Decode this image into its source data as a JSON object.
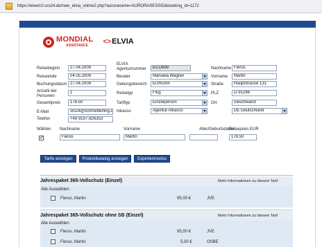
{
  "browser": {
    "url": "https://www10.sro24.de/new_elvia_online2.php?auroraname=AURORASESSID&booking_id=1172"
  },
  "logos": {
    "mondial_name": "MONDIAL",
    "mondial_sub": "ASSISTANCE",
    "elvia_mark": "<>",
    "elvia_name": "ELVIA"
  },
  "form": {
    "reisebeginn_label": "Reisebeginn",
    "reisebeginn_value": "27.04.2009",
    "reiseende_label": "Reiseende",
    "reiseende_value": "04.05.2009",
    "buchungsdatum_label": "Buchungsdatum",
    "buchungsdatum_value": "27.04.2009",
    "anzahl_label": "Anzahl der Personen",
    "anzahl_value": "1",
    "gesamtpreis_label": "Gesamtpreis",
    "gesamtpreis_value": "178.50",
    "email_label": "E-Mail",
    "email_value": "sro24@xchmetterling.de",
    "telefon_label": "Telefon",
    "telefon_value": "+49 9197-826353",
    "agenturnummer_label": "ELVIA Agenturnummer",
    "agenturnummer_value": "ECO999",
    "berater_label": "Berater",
    "berater_value": "Manuela Wagner",
    "geltungsbereich_label": "Geltungsbereich",
    "geltungsbereich_value": "EUROPA",
    "reisetyp_label": "Reisetyp",
    "reisetyp_value": "Flug",
    "tariftyp_label": "Tariftyp",
    "tariftyp_value": "Einzelperson",
    "inkasso_label": "Inkasso",
    "inkasso_value": "Agentur-Inkasso",
    "nachname_label": "Nachname",
    "nachname_value": "Fierus",
    "vorname_label": "Vorname",
    "vorname_value": "Martin",
    "strasse_label": "Straße",
    "strasse_value": "Hauptstrasse 131",
    "plz_label": "PLZ",
    "plz_value": "D-91286",
    "ort_label": "Ort",
    "ort_value": "Geschwand",
    "land_value": "DE Deutschland"
  },
  "travellers": {
    "headers": {
      "waehlen": "Wählen",
      "nachname": "Nachname",
      "vorname": "Vorname",
      "geburtsdatum": "Alter/Geburtsdatum",
      "reisepreis": "Reisepreis EUR"
    },
    "row": {
      "checked": true,
      "nachname": "Fierus",
      "vorname": "Martin",
      "geburtsdatum": "",
      "reisepreis": "178.50"
    }
  },
  "buttons": {
    "tarife": "Tarife anzeigen",
    "produktkatalog": "Produktkatalog anzeigen",
    "expertenmodus": "Expertenmodus"
  },
  "tariffs": [
    {
      "title": "Jahrespaket 365-Vollschutz (Einzel)",
      "more": "Mehr Informationen zu diesem Tarif",
      "select_all": "Alle Auswählen",
      "rows": [
        {
          "name": "Fierus, Martin",
          "price": "95,00 €",
          "code": "JVE"
        }
      ]
    },
    {
      "title": "Jahrespaket 365-Vollschutz ohne SB (Einzel)",
      "more": "Mehr Informationen zu diesem Tarif",
      "select_all": "Alle Auswählen",
      "rows": [
        {
          "name": "Fierus, Martin",
          "price": "95,00 €",
          "code": "JVE"
        },
        {
          "name": "Fierus, Martin",
          "price": "5,00 €",
          "code": "OSBE"
        }
      ]
    }
  ]
}
